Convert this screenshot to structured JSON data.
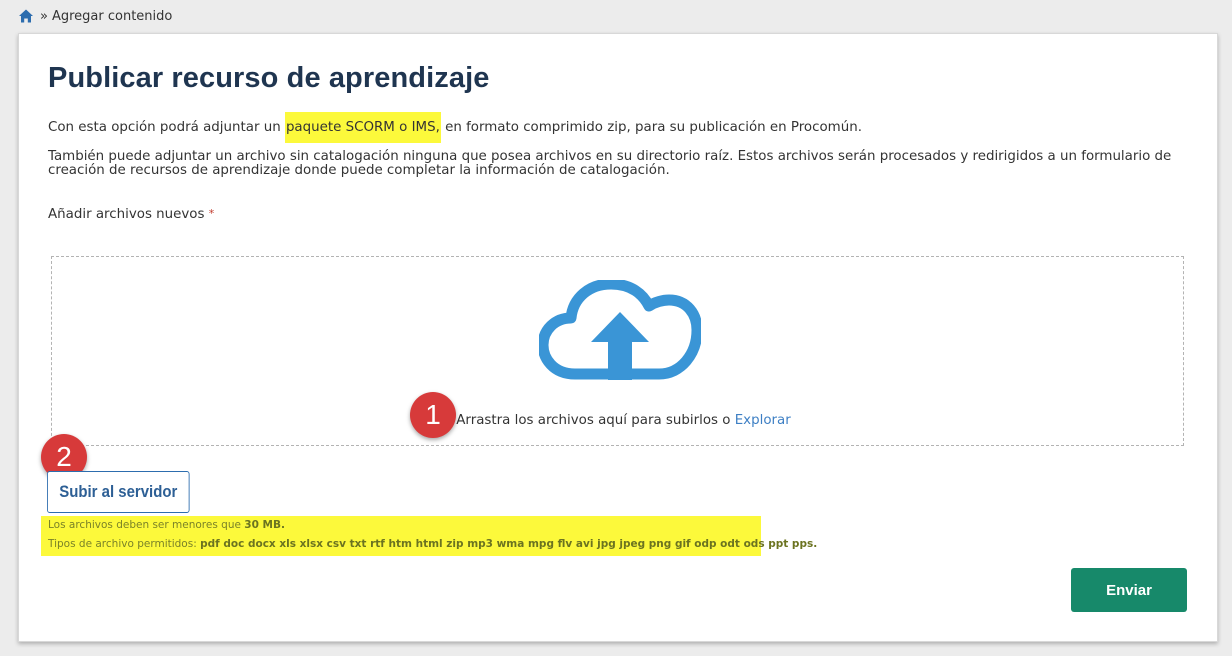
{
  "breadcrumb": {
    "home_icon": "home-icon",
    "separator": "»",
    "current": "Agregar contenido"
  },
  "page": {
    "title": "Publicar recurso de aprendizaje",
    "intro_before": "Con esta opción podrá adjuntar un ",
    "intro_highlight": "paquete SCORM o IMS,",
    "intro_after": " en formato comprimido zip, para su publicación en Procomún.",
    "description": "También puede adjuntar un archivo sin catalogación ninguna que posea archivos en su directorio raíz. Estos archivos serán procesados y redirigidos a un formulario de creación de recursos de aprendizaje donde puede completar la información de catalogación."
  },
  "upload": {
    "label": "Añadir archivos nuevos",
    "required_mark": "*",
    "drop_icon": "cloud-upload-icon",
    "drop_text": "Arrastra los archivos aquí para subirlos o",
    "browse_link": "Explorar",
    "upload_button": "Subir al servidor",
    "limit_prefix": "Los archivos deben ser menores que ",
    "limit_value": "30 MB.",
    "types_prefix": "Tipos de archivo permitidos: ",
    "types_value": "pdf doc docx xls xlsx csv txt rtf htm html zip mp3 wma mpg flv avi jpg jpeg png gif odp odt ods ppt pps."
  },
  "annotations": {
    "step1": "1",
    "step2": "2"
  },
  "actions": {
    "submit": "Enviar"
  },
  "colors": {
    "title": "#1f3550",
    "highlight": "#fcf93b",
    "link": "#3d7fc4",
    "cloud": "#3a95d6",
    "badge": "#d73a3a",
    "submit_bg": "#17896a"
  }
}
